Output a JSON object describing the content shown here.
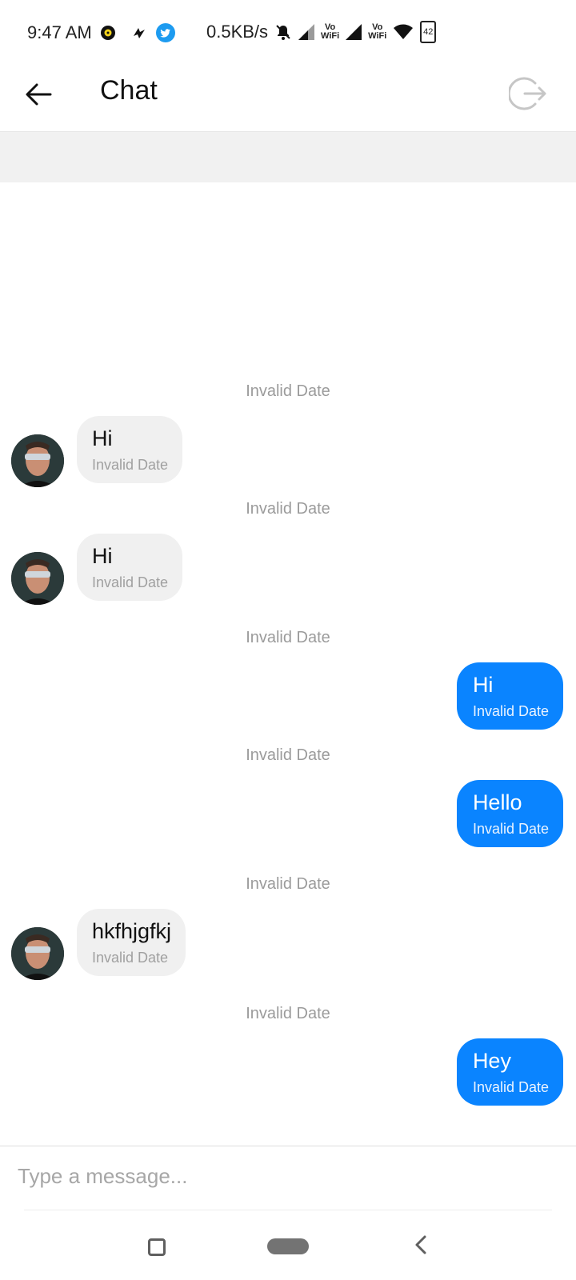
{
  "status_bar": {
    "time": "9:47 AM",
    "net_speed": "0.5KB/s",
    "battery": "42",
    "vowifi_1": "Vo\nWiFi",
    "vowifi_2": "Vo\nWiFi"
  },
  "header": {
    "title": "Chat"
  },
  "messages": [
    {
      "separator": "Invalid Date",
      "direction": "in",
      "text": "Hi",
      "time": "Invalid Date"
    },
    {
      "separator": "Invalid Date",
      "direction": "in",
      "text": "Hi",
      "time": "Invalid Date"
    },
    {
      "separator": "Invalid Date",
      "direction": "out",
      "text": "Hi",
      "time": "Invalid Date"
    },
    {
      "separator": "Invalid Date",
      "direction": "out",
      "text": "Hello",
      "time": "Invalid Date"
    },
    {
      "separator": "Invalid Date",
      "direction": "in",
      "text": "hkfhjgfkj",
      "time": "Invalid Date"
    },
    {
      "separator": "Invalid Date",
      "direction": "out",
      "text": "Hey",
      "time": "Invalid Date"
    }
  ],
  "composer": {
    "placeholder": "Type a message..."
  },
  "colors": {
    "outgoing_bubble": "#0a84ff",
    "incoming_bubble": "#f0f0f0"
  }
}
